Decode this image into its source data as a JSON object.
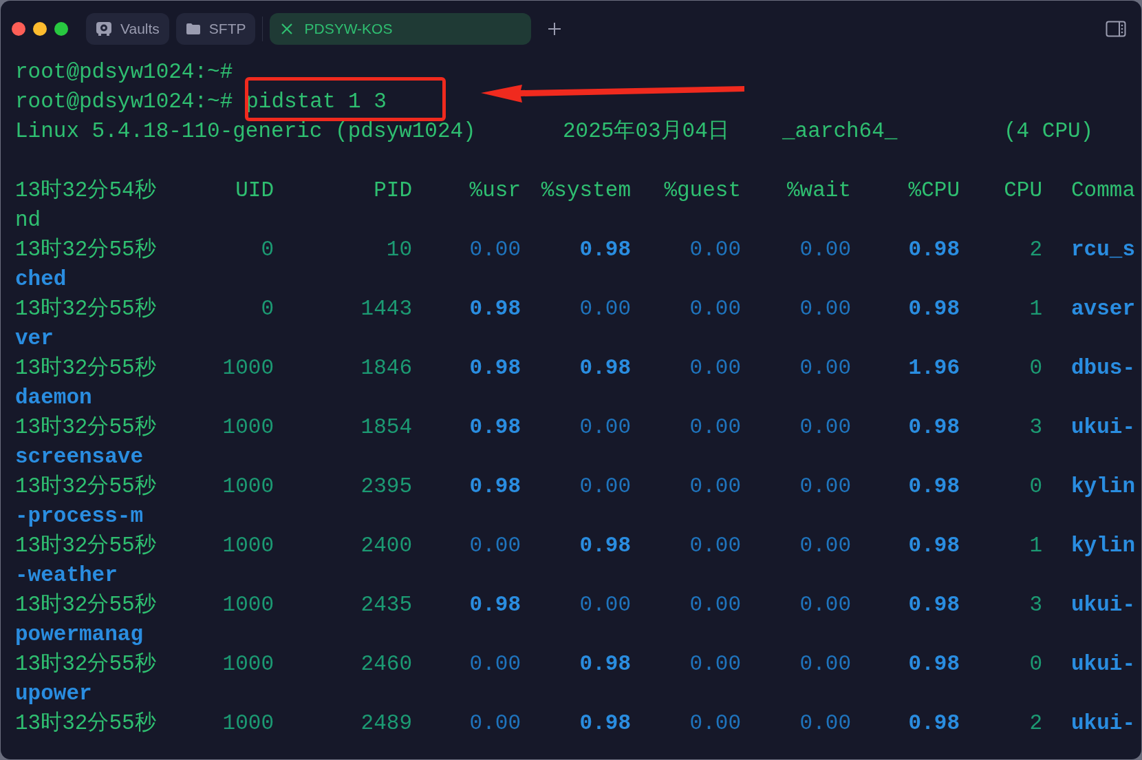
{
  "tabs": [
    {
      "label": "Vaults",
      "kind": "vault",
      "selected": false
    },
    {
      "label": "SFTP",
      "kind": "folder",
      "selected": false
    },
    {
      "label": "PDSYW-KOS",
      "kind": "close",
      "selected": true
    }
  ],
  "terminal": {
    "prompts": [
      {
        "prompt": "root@pdsyw1024:~#"
      },
      {
        "prompt": "root@pdsyw1024:~#",
        "command": "pidstat 1 3"
      }
    ],
    "system_line": [
      "Linux 5.4.18-110-generic (pdsyw1024)",
      "2025年03月04日",
      "_aarch64_",
      "(4 CPU)"
    ],
    "header": {
      "columns": [
        "13时32分54秒",
        "UID",
        "PID",
        "%usr",
        "%system",
        "%guest",
        "%wait",
        "%CPU",
        "CPU",
        "Comma"
      ],
      "wrap": "nd"
    },
    "rows": [
      {
        "time": "13时32分55秒",
        "uid": "0",
        "pid": "10",
        "values": [
          {
            "text": "0.00",
            "bold": false
          },
          {
            "text": "0.98",
            "bold": true
          },
          {
            "text": "0.00",
            "bold": false
          },
          {
            "text": "0.00",
            "bold": false
          },
          {
            "text": "0.98",
            "bold": true
          }
        ],
        "cpu": "2",
        "command": "rcu_s",
        "wrap": "ched"
      },
      {
        "time": "13时32分55秒",
        "uid": "0",
        "pid": "1443",
        "values": [
          {
            "text": "0.98",
            "bold": true
          },
          {
            "text": "0.00",
            "bold": false
          },
          {
            "text": "0.00",
            "bold": false
          },
          {
            "text": "0.00",
            "bold": false
          },
          {
            "text": "0.98",
            "bold": true
          }
        ],
        "cpu": "1",
        "command": "avser",
        "wrap": "ver"
      },
      {
        "time": "13时32分55秒",
        "uid": "1000",
        "pid": "1846",
        "values": [
          {
            "text": "0.98",
            "bold": true
          },
          {
            "text": "0.98",
            "bold": true
          },
          {
            "text": "0.00",
            "bold": false
          },
          {
            "text": "0.00",
            "bold": false
          },
          {
            "text": "1.96",
            "bold": true
          }
        ],
        "cpu": "0",
        "command": "dbus-",
        "wrap": "daemon"
      },
      {
        "time": "13时32分55秒",
        "uid": "1000",
        "pid": "1854",
        "values": [
          {
            "text": "0.98",
            "bold": true
          },
          {
            "text": "0.00",
            "bold": false
          },
          {
            "text": "0.00",
            "bold": false
          },
          {
            "text": "0.00",
            "bold": false
          },
          {
            "text": "0.98",
            "bold": true
          }
        ],
        "cpu": "3",
        "command": "ukui-",
        "wrap": "screensave"
      },
      {
        "time": "13时32分55秒",
        "uid": "1000",
        "pid": "2395",
        "values": [
          {
            "text": "0.98",
            "bold": true
          },
          {
            "text": "0.00",
            "bold": false
          },
          {
            "text": "0.00",
            "bold": false
          },
          {
            "text": "0.00",
            "bold": false
          },
          {
            "text": "0.98",
            "bold": true
          }
        ],
        "cpu": "0",
        "command": "kylin",
        "wrap": "-process-m"
      },
      {
        "time": "13时32分55秒",
        "uid": "1000",
        "pid": "2400",
        "values": [
          {
            "text": "0.00",
            "bold": false
          },
          {
            "text": "0.98",
            "bold": true
          },
          {
            "text": "0.00",
            "bold": false
          },
          {
            "text": "0.00",
            "bold": false
          },
          {
            "text": "0.98",
            "bold": true
          }
        ],
        "cpu": "1",
        "command": "kylin",
        "wrap": "-weather"
      },
      {
        "time": "13时32分55秒",
        "uid": "1000",
        "pid": "2435",
        "values": [
          {
            "text": "0.98",
            "bold": true
          },
          {
            "text": "0.00",
            "bold": false
          },
          {
            "text": "0.00",
            "bold": false
          },
          {
            "text": "0.00",
            "bold": false
          },
          {
            "text": "0.98",
            "bold": true
          }
        ],
        "cpu": "3",
        "command": "ukui-",
        "wrap": "powermanag"
      },
      {
        "time": "13时32分55秒",
        "uid": "1000",
        "pid": "2460",
        "values": [
          {
            "text": "0.00",
            "bold": false
          },
          {
            "text": "0.98",
            "bold": true
          },
          {
            "text": "0.00",
            "bold": false
          },
          {
            "text": "0.00",
            "bold": false
          },
          {
            "text": "0.98",
            "bold": true
          }
        ],
        "cpu": "0",
        "command": "ukui-",
        "wrap": "upower"
      },
      {
        "time": "13时32分55秒",
        "uid": "1000",
        "pid": "2489",
        "values": [
          {
            "text": "0.00",
            "bold": false
          },
          {
            "text": "0.98",
            "bold": true
          },
          {
            "text": "0.00",
            "bold": false
          },
          {
            "text": "0.00",
            "bold": false
          },
          {
            "text": "0.98",
            "bold": true
          }
        ],
        "cpu": "2",
        "command": "ukui-"
      }
    ]
  }
}
